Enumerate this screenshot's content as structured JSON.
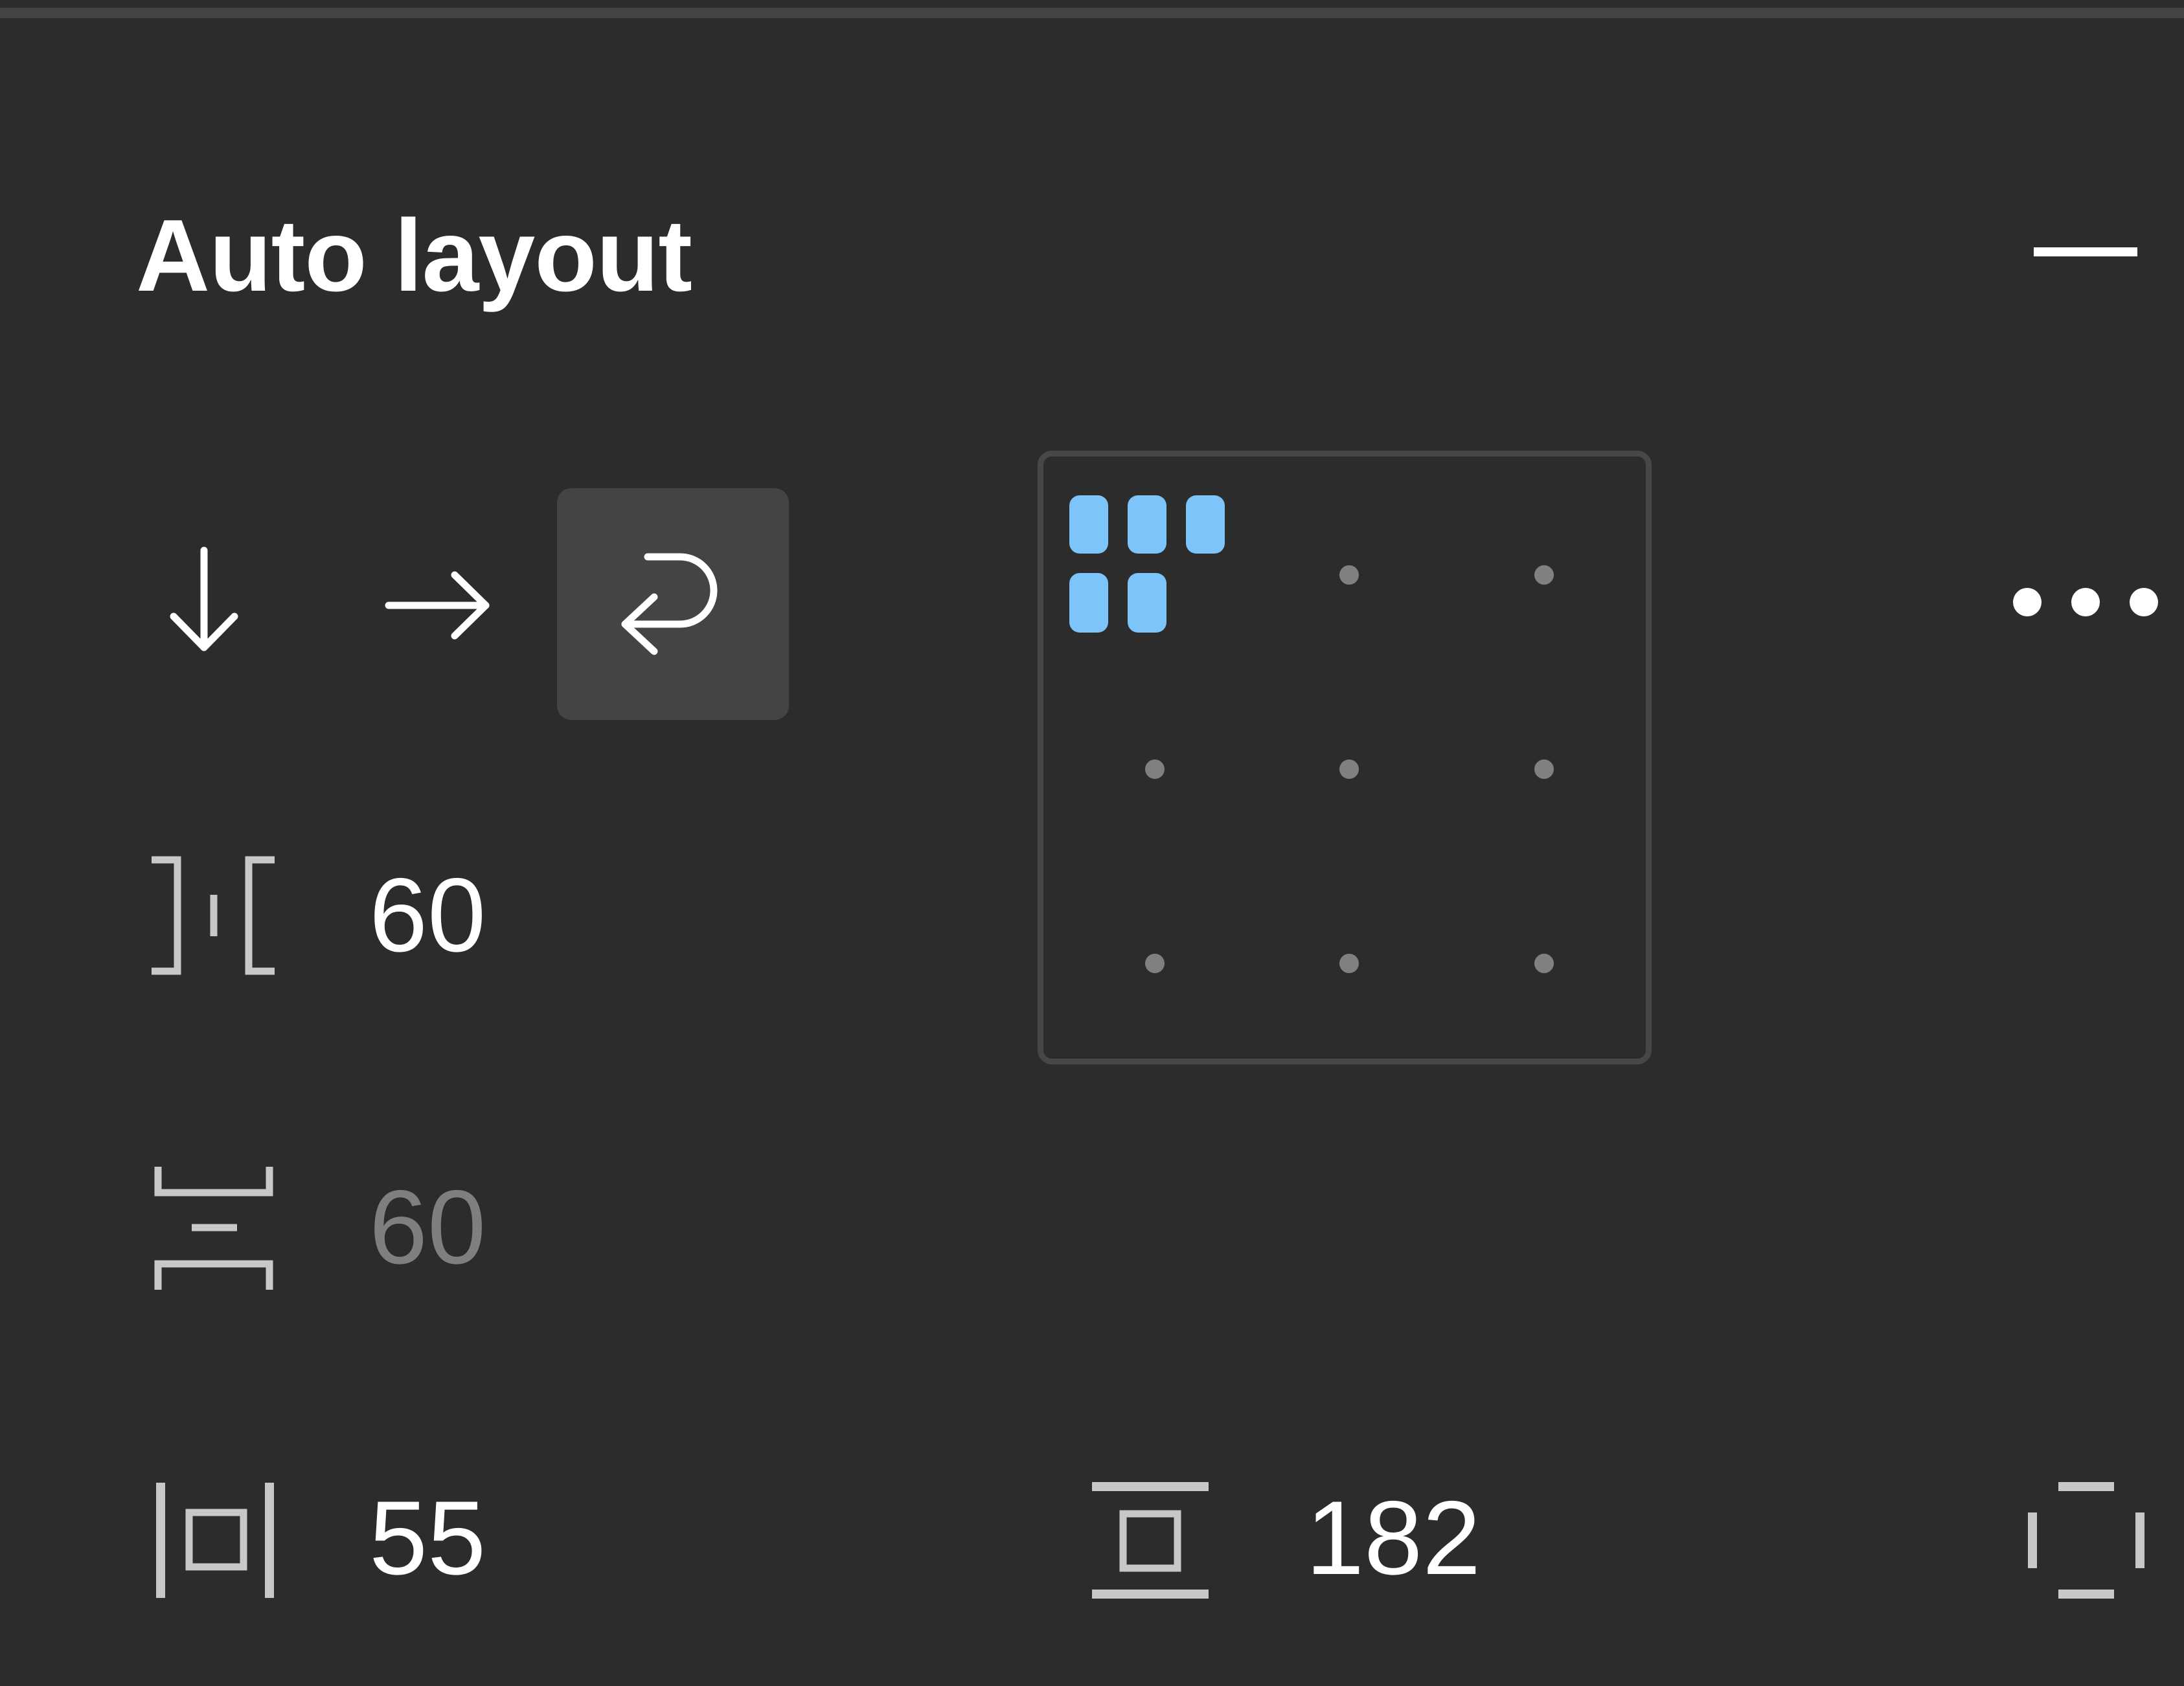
{
  "panel": {
    "title": "Auto layout",
    "collapse_icon": "minus-icon",
    "more_icon": "more-dots-icon"
  },
  "direction": {
    "options": [
      {
        "name": "vertical",
        "icon": "arrow-down-icon",
        "selected": false
      },
      {
        "name": "horizontal",
        "icon": "arrow-right-icon",
        "selected": false
      },
      {
        "name": "wrap",
        "icon": "wrap-arrow-icon",
        "selected": true
      }
    ]
  },
  "spacing": {
    "horizontal_gap": "60",
    "vertical_gap": "60",
    "horizontal_padding": "55",
    "vertical_padding": "182"
  },
  "alignment": {
    "selected": "top-left"
  },
  "colors": {
    "background": "#2c2c2c",
    "accent": "#7cc4fa",
    "selected_bg": "#444444",
    "muted_text": "#7f7f7f"
  }
}
